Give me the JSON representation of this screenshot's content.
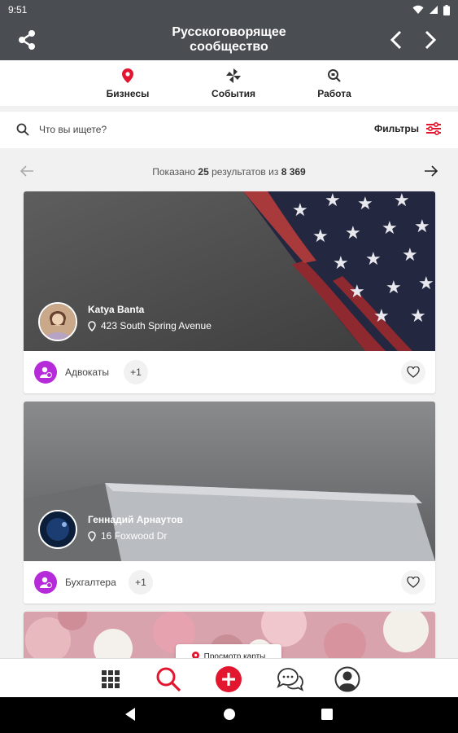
{
  "status": {
    "time": "9:51"
  },
  "appbar": {
    "title_line1": "Русскоговорящее",
    "title_line2": "сообщество"
  },
  "tabs": [
    {
      "label": "Бизнесы",
      "icon": "map-pin-icon",
      "color": "#e2172f"
    },
    {
      "label": "События",
      "icon": "pinwheel-icon"
    },
    {
      "label": "Работа",
      "icon": "search-job-icon"
    }
  ],
  "search": {
    "placeholder": "Что вы ищете?",
    "filters_label": "Фильтры"
  },
  "pager": {
    "prefix": "Показано",
    "shown": "25",
    "middle": "результатов из",
    "total": "8 369"
  },
  "cards": [
    {
      "name": "Katya Banta",
      "address": "423 South Spring Avenue",
      "category": "Адвокаты",
      "extra": "+1"
    },
    {
      "name": "Геннадий Арнаутов",
      "address": "16 Foxwood Dr",
      "category": "Бухгалтера",
      "extra": "+1"
    }
  ],
  "map_button": {
    "label": "Просмотр карты"
  },
  "bottom_nav": [
    "grid-icon",
    "search-icon",
    "add-icon",
    "chat-icon",
    "profile-icon"
  ],
  "colors": {
    "accent": "#e2172f",
    "appbar": "#4a4d52",
    "category": "#b52ad9"
  }
}
